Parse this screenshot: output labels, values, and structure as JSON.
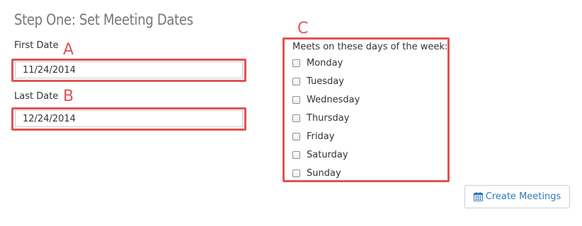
{
  "page": {
    "heading": "Step One: Set Meeting Dates"
  },
  "annotations": {
    "a": "A",
    "b": "B",
    "c": "C",
    "color": "#e05454"
  },
  "first_date": {
    "label": "First Date",
    "value": "11/24/2014"
  },
  "last_date": {
    "label": "Last Date",
    "value": "12/24/2014"
  },
  "weekdays": {
    "title": "Meets on these days of the week:",
    "days": [
      {
        "label": "Monday",
        "checked": false
      },
      {
        "label": "Tuesday",
        "checked": false
      },
      {
        "label": "Wednesday",
        "checked": false
      },
      {
        "label": "Thursday",
        "checked": false
      },
      {
        "label": "Friday",
        "checked": false
      },
      {
        "label": "Saturday",
        "checked": false
      },
      {
        "label": "Sunday",
        "checked": false
      }
    ]
  },
  "actions": {
    "create_label": "Create Meetings",
    "create_icon": "calendar-icon",
    "link_color": "#337ab7"
  }
}
